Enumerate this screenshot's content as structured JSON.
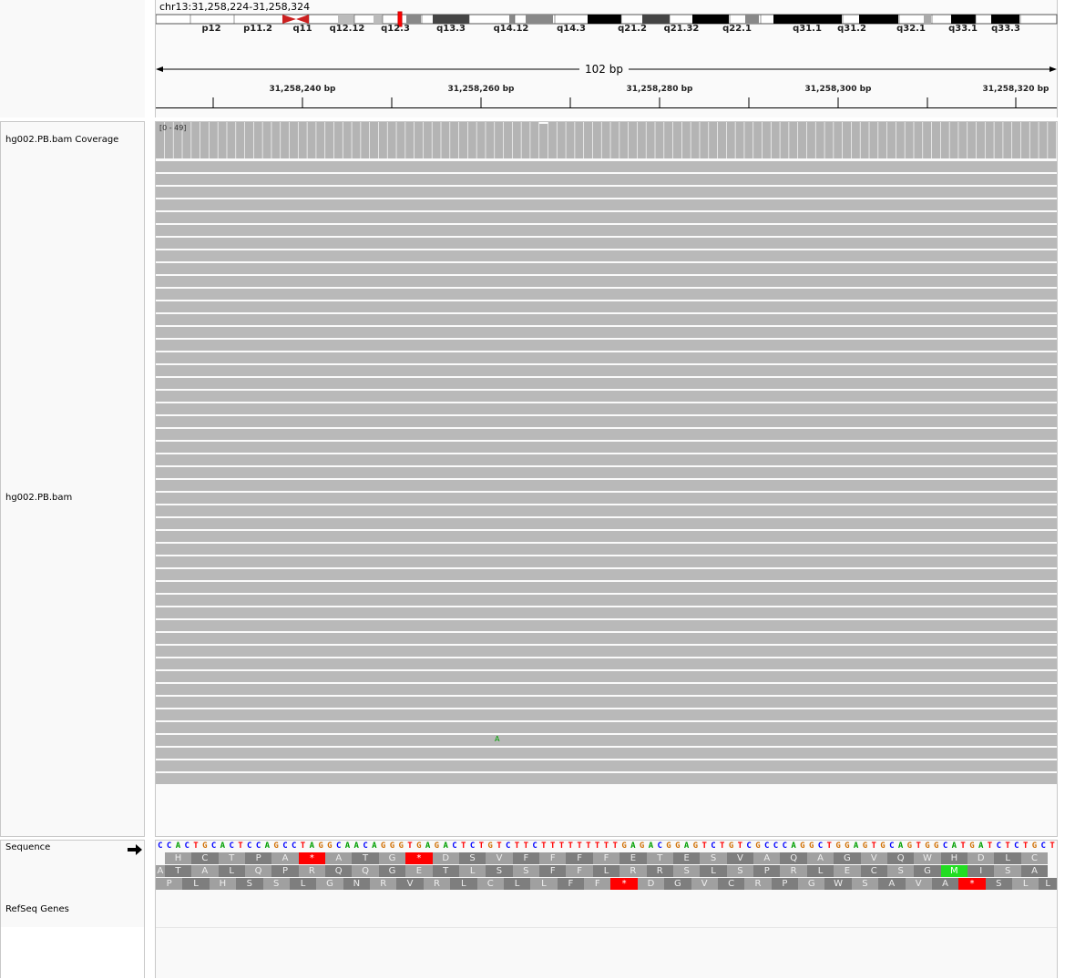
{
  "locus": "chr13:31,258,224-31,258,324",
  "span_label": "102 bp",
  "cytobands": [
    "p12",
    "p11.2",
    "q11",
    "q12.12",
    "q12.3",
    "q13.3",
    "q14.12",
    "q14.3",
    "q21.2",
    "q21.32",
    "q22.1",
    "q31.1",
    "q31.2",
    "q32.1",
    "q33.1",
    "q33.3"
  ],
  "ruler_ticks": [
    "31,258,240 bp",
    "31,258,260 bp",
    "31,258,280 bp",
    "31,258,300 bp",
    "31,258,320 bp"
  ],
  "tracks": {
    "coverage_name": "hg002.PB.bam Coverage",
    "coverage_range": "[0 - 49]",
    "alignment_name": "hg002.PB.bam",
    "sequence_name": "Sequence",
    "refseq_name": "RefSeq Genes"
  },
  "mismatch_base": "A",
  "sequence": "CCACTGCACTCCAGCCTAGGCAACAGGGTGAGACTCTGTCTTCTTTTTTTTTGAGACGGAGTCTGTCGCCCAGGCTGGAGTGCAGTGGCATGATCTCTGCT",
  "translation_frames": [
    [
      "H",
      "C",
      "T",
      "P",
      "A",
      "*",
      "A",
      "T",
      "G",
      "*",
      "D",
      "S",
      "V",
      "F",
      "F",
      "F",
      "F",
      "E",
      "T",
      "E",
      "S",
      "V",
      "A",
      "Q",
      "A",
      "G",
      "V",
      "Q",
      "W",
      "H",
      "D",
      "L",
      "C"
    ],
    [
      "A",
      "T",
      "A",
      "L",
      "Q",
      "P",
      "R",
      "Q",
      "Q",
      "G",
      "E",
      "T",
      "L",
      "S",
      "S",
      "F",
      "F",
      "L",
      "R",
      "R",
      "S",
      "L",
      "S",
      "P",
      "R",
      "L",
      "E",
      "C",
      "S",
      "G",
      "M",
      "I",
      "S",
      "A"
    ],
    [
      "P",
      "L",
      "H",
      "S",
      "S",
      "L",
      "G",
      "N",
      "R",
      "V",
      "R",
      "L",
      "C",
      "L",
      "L",
      "F",
      "F",
      "*",
      "D",
      "G",
      "V",
      "C",
      "R",
      "P",
      "G",
      "W",
      "S",
      "A",
      "V",
      "A",
      "*",
      "S",
      "L",
      "L"
    ]
  ],
  "colors": {
    "A": "#00a000",
    "C": "#0000ff",
    "G": "#d17105",
    "T": "#ff0000",
    "stop": "#ff0000",
    "start": "#22dd22",
    "centromere": "#cc2020"
  }
}
